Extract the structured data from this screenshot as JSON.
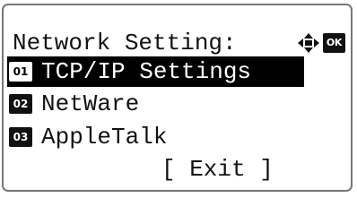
{
  "screen": {
    "title": "Network Setting:",
    "nav_icons": [
      "four-way-arrow-icon",
      "ok-key-icon"
    ],
    "ok_label": "OK"
  },
  "menu": {
    "items": [
      {
        "number": "01",
        "label": "TCP/IP Settings",
        "selected": true
      },
      {
        "number": "02",
        "label": "NetWare",
        "selected": false
      },
      {
        "number": "03",
        "label": "AppleTalk",
        "selected": false
      }
    ]
  },
  "footer": {
    "exit_label": "[ Exit ]"
  },
  "colors": {
    "background": "#ffffff",
    "text": "#111111",
    "highlight": "#000000",
    "bezel": "#777777"
  }
}
